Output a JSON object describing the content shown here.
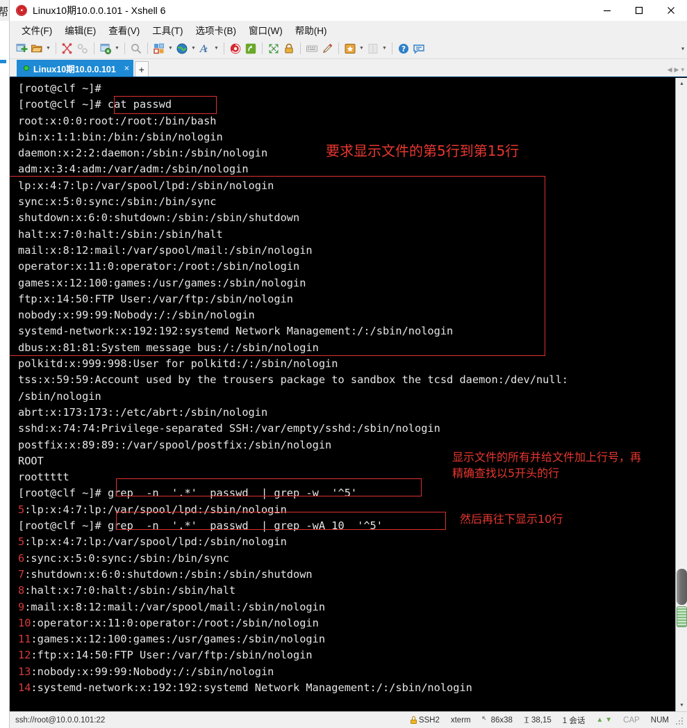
{
  "window": {
    "title": "Linux10期10.0.0.101 - Xshell 6",
    "app_icon": "xshell-spiral-icon",
    "minimize_label": "—",
    "maximize_label": "□",
    "close_label": "✕"
  },
  "menubar": {
    "items": [
      {
        "label": "文件(F)",
        "name": "menu-file"
      },
      {
        "label": "编辑(E)",
        "name": "menu-edit"
      },
      {
        "label": "查看(V)",
        "name": "menu-view"
      },
      {
        "label": "工具(T)",
        "name": "menu-tools"
      },
      {
        "label": "选项卡(B)",
        "name": "menu-tabs"
      },
      {
        "label": "窗口(W)",
        "name": "menu-window"
      },
      {
        "label": "帮助(H)",
        "name": "menu-help"
      }
    ]
  },
  "toolbar": {
    "overflow_label": "▾",
    "icons": [
      "new-session-icon",
      "open-folder-icon",
      "open-folder-dropdown-icon",
      "cut-icon",
      "link-icon",
      "session-properties-icon",
      "session-properties-dropdown-icon",
      "find-icon",
      "layout-icon",
      "layout-dropdown-icon",
      "globe-icon",
      "globe-dropdown-icon",
      "font-icon",
      "font-dropdown-icon",
      "xshell-icon",
      "xftp-icon",
      "fullscreen-icon",
      "lock-icon",
      "keyboard-icon",
      "highlight-pen-icon",
      "star-icon",
      "star-dropdown-icon",
      "column-icon",
      "column-dropdown-icon",
      "help-icon",
      "feedback-icon"
    ]
  },
  "tabbar": {
    "tab_label": "Linux10期10.0.0.101",
    "tab_close_label": "×",
    "add_tab_label": "+",
    "nav_prev_label": "◀",
    "nav_next_label": "▶",
    "nav_menu_label": "▾"
  },
  "terminal": {
    "lines": [
      "[root@clf ~]#",
      "[root@clf ~]# cat passwd",
      "root:x:0:0:root:/root:/bin/bash",
      "bin:x:1:1:bin:/bin:/sbin/nologin",
      "daemon:x:2:2:daemon:/sbin:/sbin/nologin",
      "adm:x:3:4:adm:/var/adm:/sbin/nologin",
      "lp:x:4:7:lp:/var/spool/lpd:/sbin/nologin",
      "sync:x:5:0:sync:/sbin:/bin/sync",
      "shutdown:x:6:0:shutdown:/sbin:/sbin/shutdown",
      "halt:x:7:0:halt:/sbin:/sbin/halt",
      "mail:x:8:12:mail:/var/spool/mail:/sbin/nologin",
      "operator:x:11:0:operator:/root:/sbin/nologin",
      "games:x:12:100:games:/usr/games:/sbin/nologin",
      "ftp:x:14:50:FTP User:/var/ftp:/sbin/nologin",
      "nobody:x:99:99:Nobody:/:/sbin/nologin",
      "systemd-network:x:192:192:systemd Network Management:/:/sbin/nologin",
      "dbus:x:81:81:System message bus:/:/sbin/nologin",
      "polkitd:x:999:998:User for polkitd:/:/sbin/nologin",
      "tss:x:59:59:Account used by the trousers package to sandbox the tcsd daemon:/dev/null:",
      "/sbin/nologin",
      "abrt:x:173:173::/etc/abrt:/sbin/nologin",
      "sshd:x:74:74:Privilege-separated SSH:/var/empty/sshd:/sbin/nologin",
      "postfix:x:89:89::/var/spool/postfix:/sbin/nologin",
      "ROOT",
      "roottttt"
    ],
    "prompt": "[root@clf ~]# ",
    "cmd1": "grep  -n  '.*'  passwd  | grep -w  '^5'",
    "cmd2": "grep  -n  '.*'  passwd  | grep -wA 10  '^5'",
    "result1_num": "5",
    "result1_rest": ":lp:x:4:7:lp:/var/spool/lpd:/sbin/nologin",
    "result2": [
      {
        "num": "5",
        "rest": ":lp:x:4:7:lp:/var/spool/lpd:/sbin/nologin"
      },
      {
        "num": "6",
        "rest": ":sync:x:5:0:sync:/sbin:/bin/sync"
      },
      {
        "num": "7",
        "rest": ":shutdown:x:6:0:shutdown:/sbin:/sbin/shutdown"
      },
      {
        "num": "8",
        "rest": ":halt:x:7:0:halt:/sbin:/sbin/halt"
      },
      {
        "num": "9",
        "rest": ":mail:x:8:12:mail:/var/spool/mail:/sbin/nologin"
      },
      {
        "num": "10",
        "rest": ":operator:x:11:0:operator:/root:/sbin/nologin"
      },
      {
        "num": "11",
        "rest": ":games:x:12:100:games:/usr/games:/sbin/nologin"
      },
      {
        "num": "12",
        "rest": ":ftp:x:14:50:FTP User:/var/ftp:/sbin/nologin"
      },
      {
        "num": "13",
        "rest": ":nobody:x:99:99:Nobody:/:/sbin/nologin"
      },
      {
        "num": "14",
        "rest": ":systemd-network:x:192:192:systemd Network Management:/:/sbin/nologin"
      }
    ]
  },
  "annotations": {
    "note_range": "要求显示文件的第5行到第15行",
    "note_linenum": "显示文件的所有并给文件加上行号，再\n精确查找以5开头的行",
    "note_after": "然后再往下显示10行",
    "color": "#e8372f"
  },
  "statusbar": {
    "connection": "ssh://root@10.0.0.101:22",
    "protocol": "SSH2",
    "terminal_type": "xterm",
    "size": "86x38",
    "cursor": "38,15",
    "sessions": "1 会话",
    "cap": "CAP",
    "num": "NUM",
    "size_icon": "resize-icon",
    "cursor_icon": "cursor-icon",
    "lock_icon": "lock-icon",
    "up_arrow": "▲",
    "down_arrow": "▼"
  },
  "scrollbar": {
    "up_label": "▲",
    "down_label": "▼"
  }
}
